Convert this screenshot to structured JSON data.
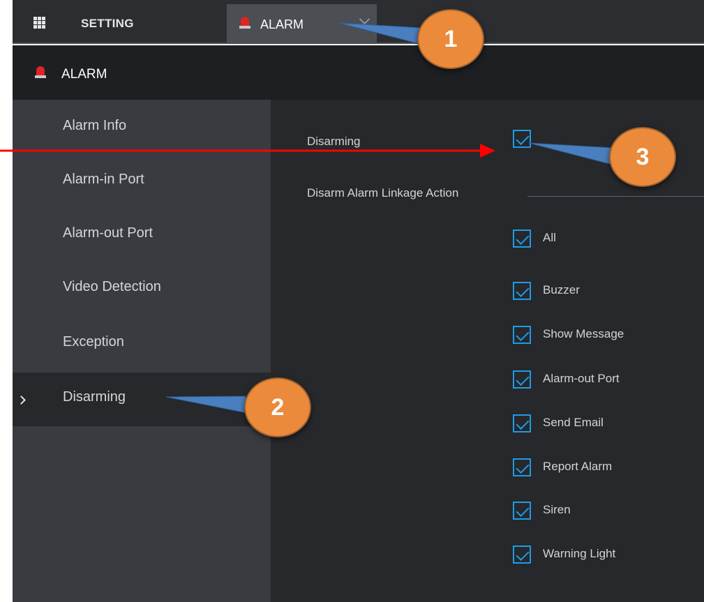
{
  "topbar": {
    "icon": "grid-icon",
    "setting_label": "SETTING",
    "tab": {
      "icon": "siren-icon",
      "label": "ALARM",
      "dropdown_icon": "chevron-down-icon"
    }
  },
  "section": {
    "icon": "siren-icon",
    "title": "ALARM"
  },
  "sidebar": {
    "items": [
      {
        "label": "Alarm Info",
        "active": false
      },
      {
        "label": "Alarm-in Port",
        "active": false
      },
      {
        "label": "Alarm-out Port",
        "active": false
      },
      {
        "label": "Video Detection",
        "active": false
      },
      {
        "label": "Exception",
        "active": false
      },
      {
        "label": "Disarming",
        "active": true
      }
    ]
  },
  "main": {
    "disarming": {
      "label": "Disarming",
      "checked": true
    },
    "linkage": {
      "title": "Disarm Alarm Linkage Action",
      "options": [
        {
          "label": "All",
          "checked": true
        },
        {
          "label": "Buzzer",
          "checked": true
        },
        {
          "label": "Show Message",
          "checked": true
        },
        {
          "label": "Alarm-out Port",
          "checked": true
        },
        {
          "label": "Send Email",
          "checked": true
        },
        {
          "label": "Report Alarm",
          "checked": true
        },
        {
          "label": "Siren",
          "checked": true
        },
        {
          "label": "Warning Light",
          "checked": true
        }
      ]
    }
  },
  "callouts": [
    "1",
    "2",
    "3"
  ],
  "colors": {
    "accent_blue": "#1e9be8",
    "callout_orange": "#ea8a3a",
    "siren_red": "#e02424",
    "arrow_red": "#ff0000"
  }
}
